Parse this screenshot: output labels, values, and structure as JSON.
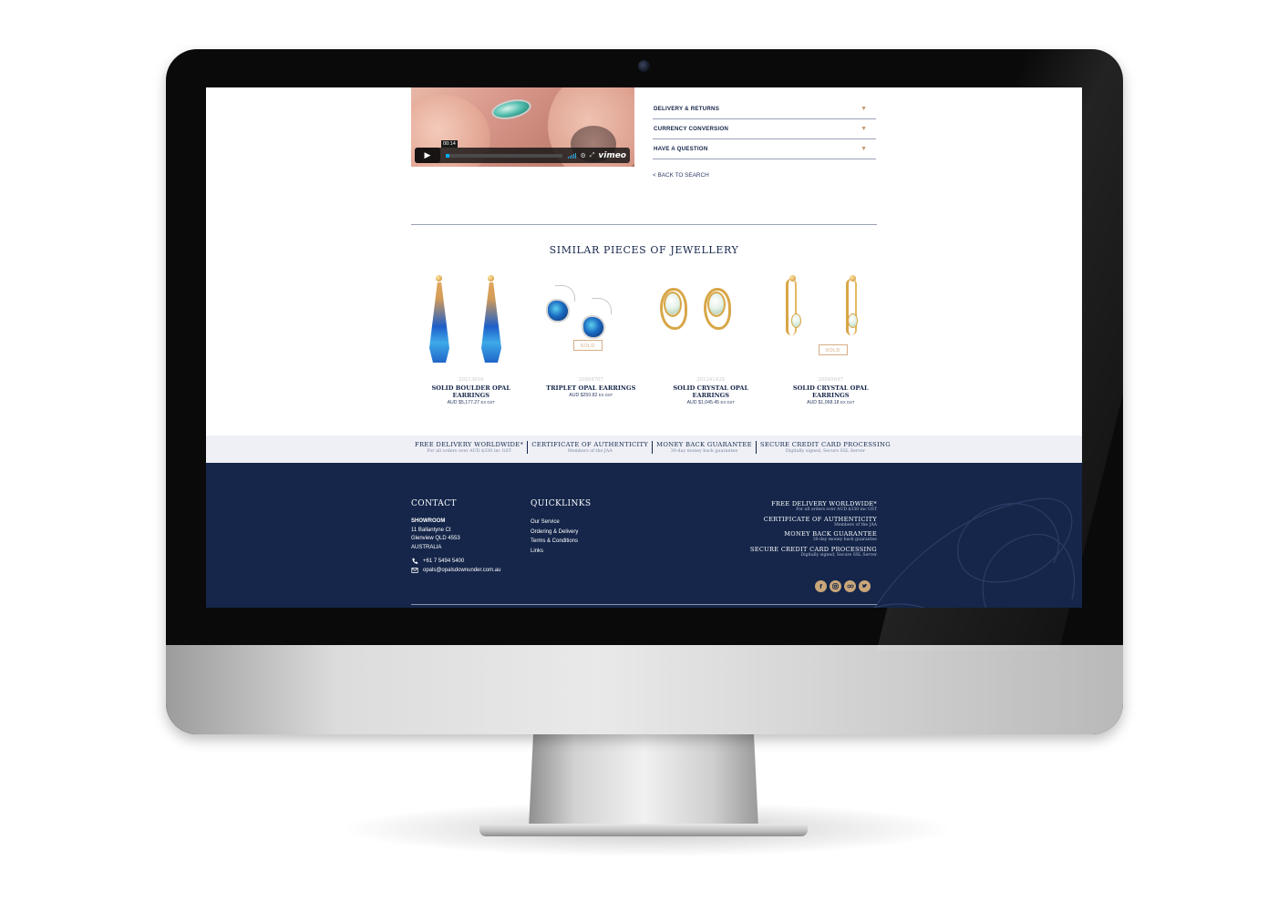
{
  "accordion": [
    {
      "label": "DELIVERY & RETURNS"
    },
    {
      "label": "CURRENCY CONVERSION"
    },
    {
      "label": "HAVE A QUESTION"
    }
  ],
  "back_link": "< BACK TO SEARCH",
  "video": {
    "timestamp": "00:14",
    "provider": "vimeo",
    "progress": 0.03
  },
  "similar": {
    "title": "SIMILAR PIECES OF JEWELLERY",
    "products": [
      {
        "sku": "20213916",
        "name": "SOLID BOULDER OPAL EARRINGS",
        "price": "AUD $5,177.27",
        "tax": "EX GST",
        "sold": false
      },
      {
        "sku": "20004707",
        "name": "TRIPLET OPAL EARRINGS",
        "price": "AUD $250.82",
        "tax": "EX GST",
        "sold": true,
        "sold_label": "SOLD"
      },
      {
        "sku": "20124142X",
        "name": "SOLID CRYSTAL OPAL EARRINGS",
        "price": "AUD $1,045.45",
        "tax": "EX GST",
        "sold": false
      },
      {
        "sku": "20045647",
        "name": "SOLID CRYSTAL OPAL EARRINGS",
        "price": "AUD $1,068.18",
        "tax": "EX GST",
        "sold": true,
        "sold_label": "SOLD"
      }
    ]
  },
  "benefits": [
    {
      "title": "FREE DELIVERY WORLDWIDE*",
      "sub": "For all orders over AUD $330 inc GST"
    },
    {
      "title": "CERTIFICATE OF AUTHENTICITY",
      "sub": "Members of the JAA"
    },
    {
      "title": "MONEY BACK GUARANTEE",
      "sub": "30-day money back guarantee"
    },
    {
      "title": "SECURE CREDIT CARD PROCESSING",
      "sub": "Digitally signed, Secure SSL Server"
    }
  ],
  "footer": {
    "contact": {
      "title": "CONTACT",
      "showroom_label": "SHOWROOM",
      "address_line1": "11 Ballantyne Ct",
      "address_line2": "Glenview QLD 4553",
      "address_line3": "AUSTRALIA",
      "phone": "+61 7 5494 5400",
      "email": "opals@opalsdownunder.com.au"
    },
    "quicklinks": {
      "title": "QUICKLINKS",
      "items": [
        "Our Service",
        "Ordering & Delivery",
        "Terms & Conditions",
        "Links"
      ]
    },
    "social_icons": [
      "facebook-icon",
      "instagram-icon",
      "tripadvisor-icon",
      "twitter-icon"
    ]
  },
  "colors": {
    "navy": "#15264a",
    "gold": "#c9a679",
    "strip": "#eef0f6"
  }
}
